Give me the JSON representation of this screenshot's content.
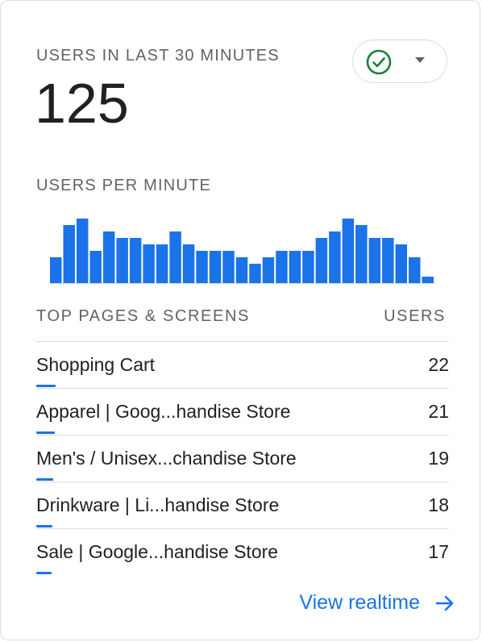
{
  "header": {
    "title": "USERS IN LAST 30 MINUTES",
    "value": "125",
    "status_icon": "check-circle-icon",
    "dropdown_icon": "caret-down-icon",
    "status_color": "#188038"
  },
  "chart_data": {
    "type": "bar",
    "title": "USERS PER MINUTE",
    "values": [
      4,
      9,
      10,
      5,
      8,
      7,
      7,
      6,
      6,
      8,
      6,
      5,
      5,
      5,
      4,
      3,
      4,
      5,
      5,
      5,
      7,
      8,
      10,
      9,
      7,
      7,
      6,
      4,
      1
    ],
    "ylim": [
      0,
      11
    ],
    "color": "#1a73e8"
  },
  "table": {
    "col_pages": "TOP PAGES & SCREENS",
    "col_users": "USERS",
    "rows": [
      {
        "page": "Shopping Cart",
        "users": "22",
        "share": 1.0
      },
      {
        "page": "Apparel | Goog...handise Store",
        "users": "21",
        "share": 0.955
      },
      {
        "page": "Men's / Unisex...chandise Store",
        "users": "19",
        "share": 0.864
      },
      {
        "page": "Drinkware | Li...handise Store",
        "users": "18",
        "share": 0.818
      },
      {
        "page": "Sale | Google...handise Store",
        "users": "17",
        "share": 0.773
      }
    ]
  },
  "footer": {
    "link_label": "View realtime",
    "link_icon": "arrow-right-icon",
    "accent": "#1a73e8"
  }
}
